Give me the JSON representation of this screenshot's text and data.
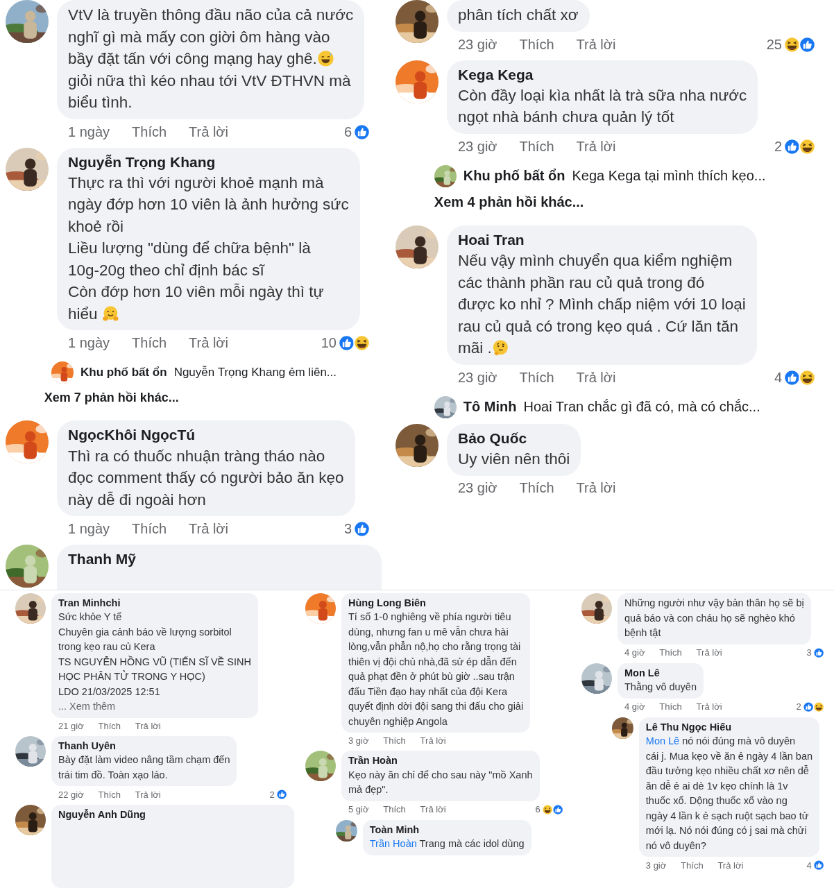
{
  "top": {
    "columns": [
      [
        {
          "kind": "comment",
          "nested": false,
          "body": [
            {
              "kind": "text",
              "text": "VtV là truyền thông đầu não của cả nước\nnghĩ gì mà mấy con giời ôm hàng vào\nbầy đặt tấn với công mạng hay ghê."
            },
            {
              "kind": "grin"
            },
            {
              "kind": "text",
              "text": "\ngiỏi nữa thì kéo nhau tới VtV ĐTHVN mà\nbiểu tình."
            }
          ],
          "time": "1 ngày",
          "like_label": "Thích",
          "reply_label": "Trả lời",
          "reactions": {
            "count": "6",
            "icons": [
              {
                "kind": "like"
              }
            ]
          }
        },
        {
          "kind": "comment",
          "nested": false,
          "name": "Nguyễn Trọng Khang",
          "body": [
            {
              "kind": "text",
              "text": "Thực ra thì với người khoẻ mạnh mà\nngày đớp hơn 10 viên là ảnh hưởng sức\nkhoẻ rồi\nLiều lượng \"dùng để chữa bệnh\" là\n10g-20g theo chỉ định bác sĩ\nCòn đớp hơn 10 viên mỗi ngày thì tự\nhiểu "
            },
            {
              "kind": "hug"
            }
          ],
          "time": "1 ngày",
          "like_label": "Thích",
          "reply_label": "Trả lời",
          "reactions": {
            "count": "10",
            "icons": [
              {
                "kind": "like"
              },
              {
                "kind": "haha"
              }
            ]
          }
        },
        {
          "kind": "reply_preview",
          "name": "Khu phố bất ổn",
          "text": "Nguyễn Trọng Khang ẻm liên..."
        },
        {
          "kind": "more_replies",
          "text": "Xem 7 phản hồi khác..."
        },
        {
          "kind": "comment",
          "nested": false,
          "name": "NgọcKhôi NgọcTú",
          "body": [
            {
              "kind": "text",
              "text": "Thì ra có thuốc nhuận tràng tháo nào\nđọc comment thấy có người bảo ăn kẹo\nnày dễ đi ngoài hơn"
            }
          ],
          "time": "1 ngày",
          "like_label": "Thích",
          "reply_label": "Trả lời",
          "reactions": {
            "count": "3",
            "icons": [
              {
                "kind": "like"
              }
            ]
          }
        },
        {
          "kind": "comment",
          "nested": false,
          "name": "Thanh Mỹ"
        }
      ],
      [
        {
          "kind": "comment",
          "nested": false,
          "body": [
            {
              "kind": "text",
              "text": "phân tích chất xơ"
            }
          ],
          "time": "23 giờ",
          "like_label": "Thích",
          "reply_label": "Trả lời",
          "reactions": {
            "count": "25",
            "icons": [
              {
                "kind": "haha"
              },
              {
                "kind": "like"
              }
            ]
          }
        },
        {
          "kind": "comment",
          "nested": false,
          "name": "Kega Kega",
          "body": [
            {
              "kind": "text",
              "text": "Còn đầy loại kìa nhất là trà sữa nha nước\nngọt nhà bánh chưa quản lý tốt"
            }
          ],
          "time": "23 giờ",
          "like_label": "Thích",
          "reply_label": "Trả lời",
          "reactions": {
            "count": "2",
            "icons": [
              {
                "kind": "like"
              },
              {
                "kind": "haha"
              }
            ]
          }
        },
        {
          "kind": "reply_preview",
          "name": "Khu phố bất ổn",
          "text": "Kega Kega tại mình thích kẹo..."
        },
        {
          "kind": "more_replies",
          "text": "Xem 4 phản hồi khác..."
        },
        {
          "kind": "comment",
          "nested": false,
          "name": "Hoai Tran",
          "body": [
            {
              "kind": "text",
              "text": "Nếu vậy mình chuyển qua kiểm nghiệm\ncác thành phần rau củ quả trong đó\nđược ko nhỉ ? Mình chấp niệm với 10 loại\nrau củ quả có trong kẹo quá . Cứ lăn tăn\nmãi ."
            },
            {
              "kind": "think"
            }
          ],
          "time": "23 giờ",
          "like_label": "Thích",
          "reply_label": "Trả lời",
          "reactions": {
            "count": "4",
            "icons": [
              {
                "kind": "like"
              },
              {
                "kind": "haha"
              }
            ]
          }
        },
        {
          "kind": "reply_preview",
          "name": "Tô Minh",
          "text": "Hoai Tran chắc gì đã có, mà có chắc..."
        },
        {
          "kind": "comment",
          "nested": false,
          "name": "Bảo Quốc",
          "body": [
            {
              "kind": "text",
              "text": "Uy viên nên thôi"
            }
          ],
          "time": "23 giờ",
          "like_label": "Thích",
          "reply_label": "Trả lời"
        }
      ]
    ]
  },
  "bottom": {
    "columns": [
      [
        {
          "kind": "comment",
          "nested": false,
          "name": "Tran Minhchi",
          "body": [
            {
              "kind": "text",
              "text": "Sức khỏe Y tế\nChuyên gia cảnh báo về lượng sorbitol\ntrong kẹo rau củ Kera\nTS NGUYỄN HỒNG VŨ (TIẾN SĨ VỀ SINH\nHỌC PHÂN TỬ TRONG Y HỌC)\nLDO  21/03/2025 12:51\n"
            },
            {
              "kind": "more_link",
              "text": "... Xem thêm"
            }
          ],
          "time": "21 giờ",
          "like_label": "Thích",
          "reply_label": "Trả lời"
        },
        {
          "kind": "comment",
          "nested": false,
          "name": "Thanh Uyên",
          "body": [
            {
              "kind": "text",
              "text": "Bày đặt làm video nâng tầm chạm đến\ntrái tim đồ. Toàn xạo láo."
            }
          ],
          "time": "22 giờ",
          "like_label": "Thích",
          "reply_label": "Trả lời",
          "reactions": {
            "count": "2",
            "icons": [
              {
                "kind": "like"
              }
            ]
          }
        },
        {
          "kind": "comment",
          "nested": false,
          "name": "Nguyễn Anh Dũng"
        }
      ],
      [
        {
          "kind": "comment",
          "nested": false,
          "name": "Hùng Long Biên",
          "body": [
            {
              "kind": "text",
              "text": "Tí số 1-0 nghiêng về phía người tiêu\ndùng, nhưng fan u mê vẫn chưa hài\nlòng,vẫn phẫn nộ,họ cho rằng trọng tài\nthiên vị đội chủ nhà,đã sử ép dẫn đến\nquả phạt đền ở phút bù giờ ..sau trận\nđấu Tiền đạo hay nhất của đội Kera\nquyết định dời đội sang thi đấu cho giải\nchuyên nghiệp Angola"
            }
          ],
          "time": "3 giờ",
          "like_label": "Thích",
          "reply_label": "Trả lời"
        },
        {
          "kind": "comment",
          "nested": false,
          "name": "Trần Hoàn",
          "body": [
            {
              "kind": "text",
              "text": "Kẹo này ăn chỉ để cho sau này \"mồ Xanh\nmả đẹp\"."
            }
          ],
          "time": "5 giờ",
          "like_label": "Thích",
          "reply_label": "Trả lời",
          "reactions": {
            "count": "6",
            "icons": [
              {
                "kind": "haha"
              },
              {
                "kind": "like"
              }
            ]
          }
        },
        {
          "kind": "comment",
          "nested": true,
          "name": "Toàn Minh",
          "body": [
            {
              "kind": "mention",
              "text": "Trần Hoàn"
            },
            {
              "kind": "text",
              "text": " Trang mà các idol dùng"
            }
          ]
        }
      ],
      [
        {
          "kind": "comment",
          "nested": false,
          "body": [
            {
              "kind": "text",
              "text": "Những người như vậy bản thân họ sẽ bị\nquả báo và con cháu họ sẽ nghèo khó\nbệnh tật"
            }
          ],
          "time": "4 giờ",
          "like_label": "Thích",
          "reply_label": "Trả lời",
          "reactions": {
            "count": "3",
            "icons": [
              {
                "kind": "like"
              }
            ]
          }
        },
        {
          "kind": "comment",
          "nested": false,
          "name": "Mon Lê",
          "body": [
            {
              "kind": "text",
              "text": "Thằng vô duyên"
            }
          ],
          "time": "4 giờ",
          "like_label": "Thích",
          "reply_label": "Trả lời",
          "reactions": {
            "count": "2",
            "icons": [
              {
                "kind": "like"
              },
              {
                "kind": "haha"
              }
            ]
          }
        },
        {
          "kind": "comment",
          "nested": true,
          "name": "Lê Thu Ngọc Hiếu",
          "body": [
            {
              "kind": "mention",
              "text": "Mon Lê"
            },
            {
              "kind": "text",
              "text": " nó nói đúng mà vô duyên\ncái j. Mua kẹo về ăn ẻ ngày 4 lần ban\nđầu tưởng kẹo nhiều chất xơ nên dễ\năn dễ ẻ ai dè 1v kẹo chính là 1v\nthuốc xổ. Dộng thuốc xổ vào ng\nngày 4 lần k ẻ sạch ruột sạch bao tử\nmới lạ. Nó nói đúng có j sai mà chửi\nnó vô duyên?"
            }
          ],
          "time": "3 giờ",
          "like_label": "Thích",
          "reply_label": "Trả lời",
          "reactions": {
            "count": "4",
            "icons": [
              {
                "kind": "like"
              }
            ]
          }
        }
      ]
    ]
  }
}
